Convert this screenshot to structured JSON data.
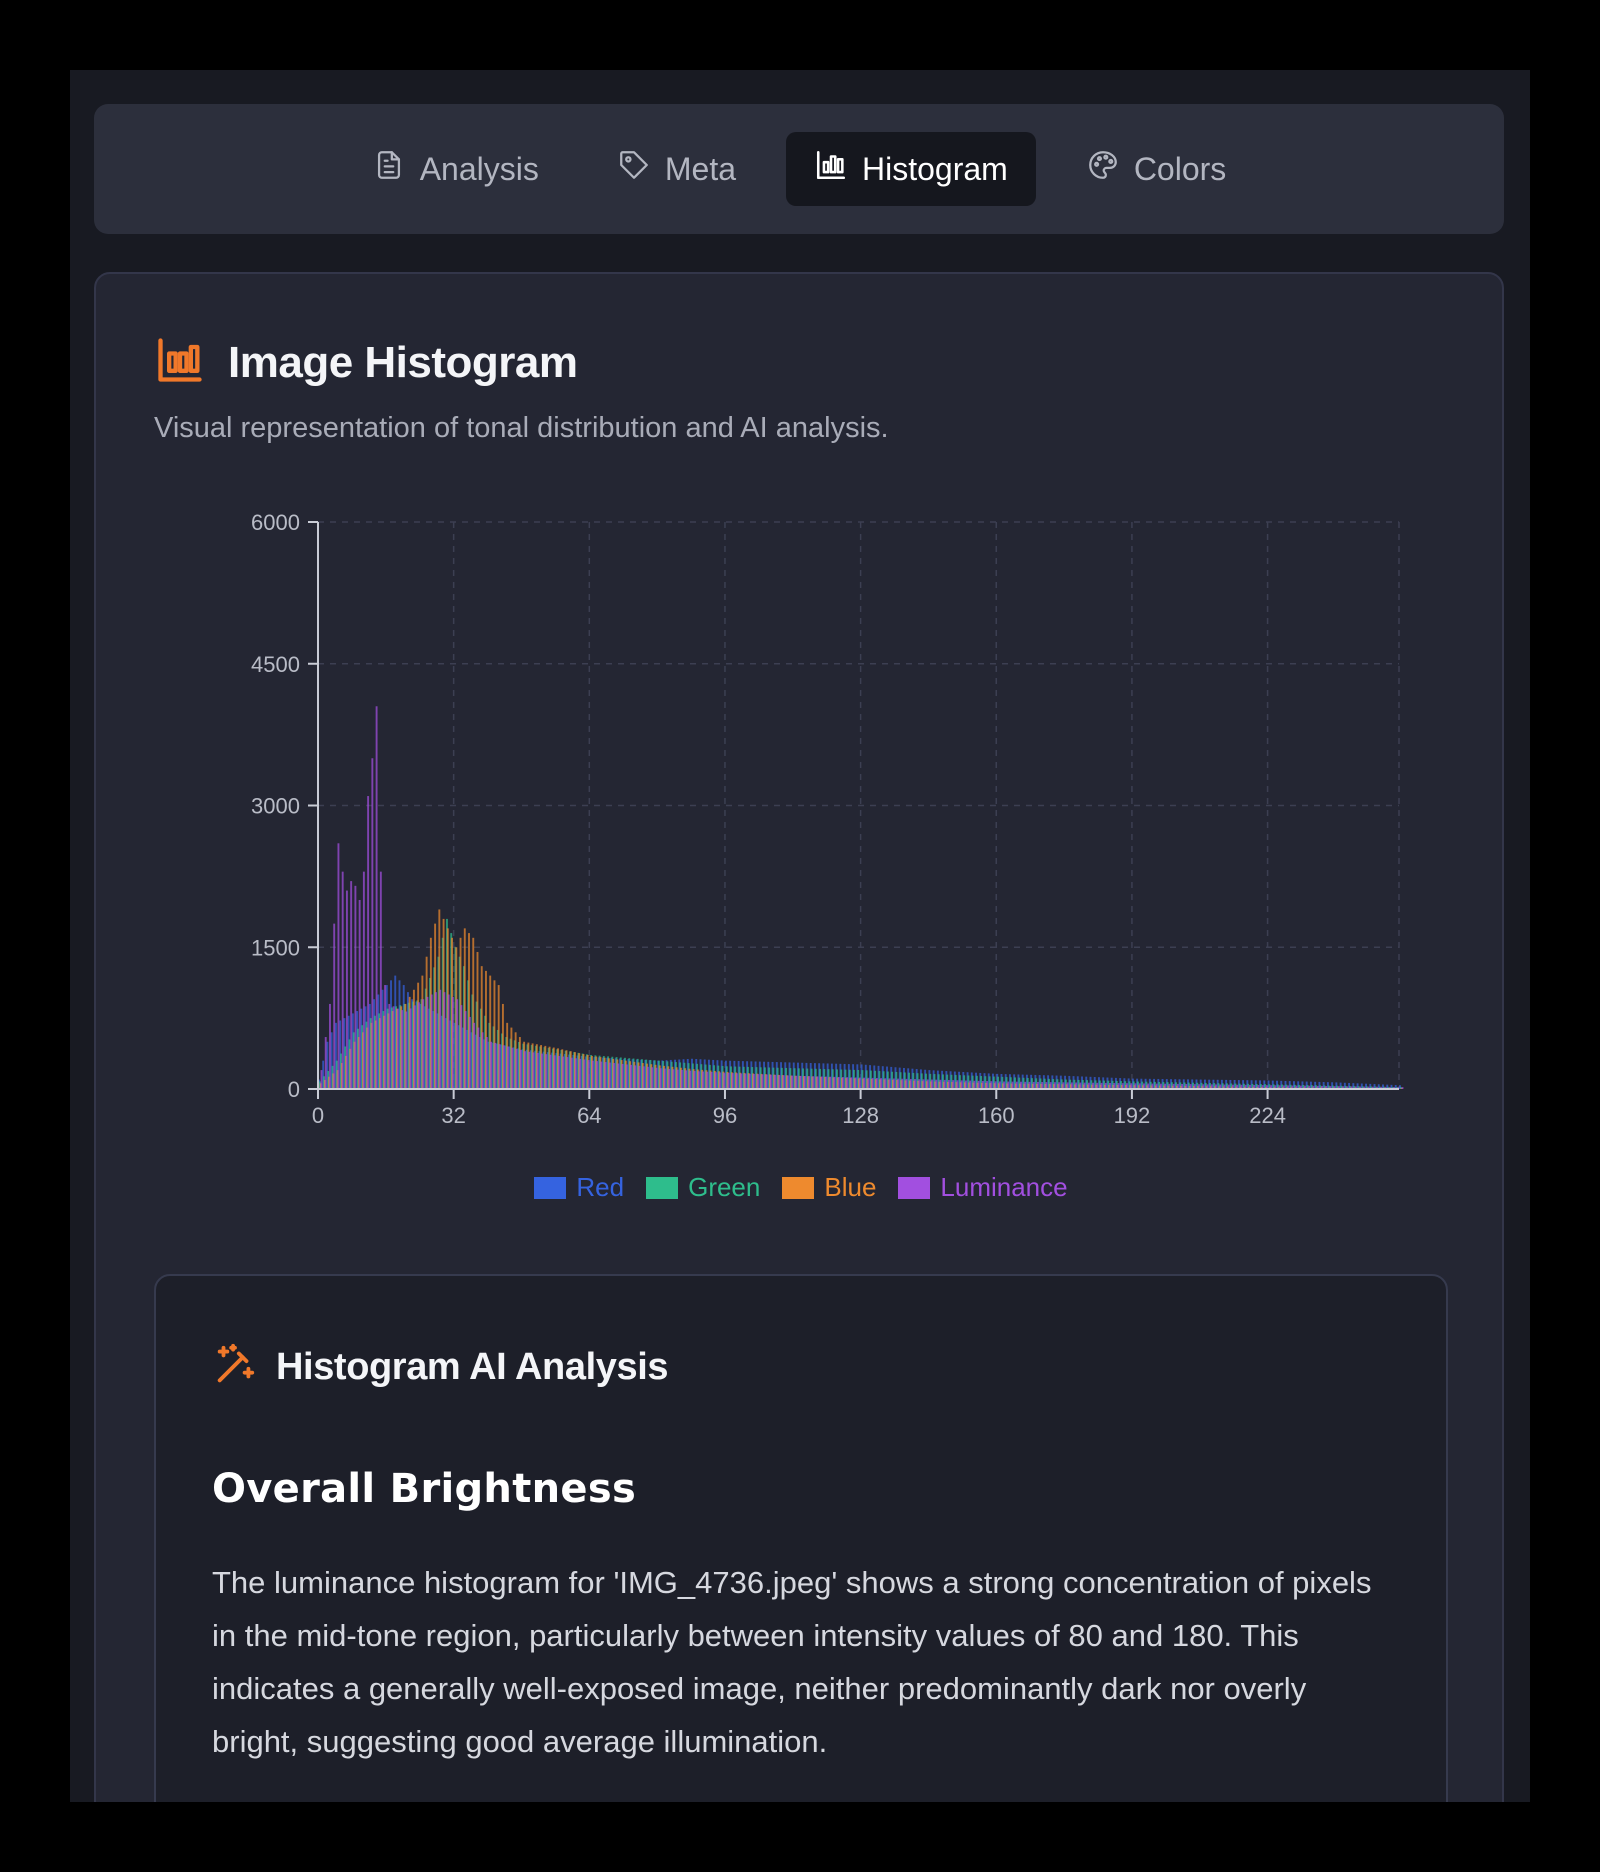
{
  "tabs": [
    {
      "label": "Analysis",
      "icon": "document-icon",
      "active": false
    },
    {
      "label": "Meta",
      "icon": "tag-icon",
      "active": false
    },
    {
      "label": "Histogram",
      "icon": "bar-chart-icon",
      "active": true
    },
    {
      "label": "Colors",
      "icon": "palette-icon",
      "active": false
    }
  ],
  "card": {
    "title": "Image Histogram",
    "subtitle": "Visual representation of tonal distribution and AI analysis."
  },
  "colors": {
    "accent": "#f0782a",
    "red": "#3563e0",
    "green": "#2ebd8c",
    "blue": "#ee8a2e",
    "luminance": "#a24fe0"
  },
  "chart_data": {
    "type": "bar",
    "x_range": [
      0,
      255
    ],
    "xticks": [
      0,
      32,
      64,
      96,
      128,
      160,
      192,
      224
    ],
    "yticks": [
      0,
      1500,
      3000,
      4500,
      6000
    ],
    "ylim": [
      0,
      6000
    ],
    "grid": true,
    "legend_position": "bottom-center",
    "series": [
      {
        "name": "Red",
        "color": "#3563e0",
        "points": [
          [
            0,
            100
          ],
          [
            2,
            500
          ],
          [
            4,
            700
          ],
          [
            6,
            750
          ],
          [
            8,
            800
          ],
          [
            10,
            850
          ],
          [
            12,
            900
          ],
          [
            14,
            1000
          ],
          [
            16,
            1100
          ],
          [
            18,
            1200
          ],
          [
            20,
            1100
          ],
          [
            22,
            950
          ],
          [
            24,
            900
          ],
          [
            26,
            850
          ],
          [
            28,
            800
          ],
          [
            30,
            750
          ],
          [
            32,
            700
          ],
          [
            36,
            600
          ],
          [
            40,
            500
          ],
          [
            48,
            420
          ],
          [
            56,
            380
          ],
          [
            64,
            340
          ],
          [
            72,
            320
          ],
          [
            80,
            300
          ],
          [
            88,
            320
          ],
          [
            96,
            300
          ],
          [
            104,
            290
          ],
          [
            112,
            280
          ],
          [
            120,
            270
          ],
          [
            128,
            260
          ],
          [
            136,
            230
          ],
          [
            144,
            200
          ],
          [
            152,
            180
          ],
          [
            160,
            160
          ],
          [
            176,
            140
          ],
          [
            192,
            110
          ],
          [
            208,
            100
          ],
          [
            224,
            90
          ],
          [
            240,
            70
          ],
          [
            255,
            40
          ]
        ]
      },
      {
        "name": "Green",
        "color": "#2ebd8c",
        "points": [
          [
            0,
            80
          ],
          [
            4,
            300
          ],
          [
            8,
            600
          ],
          [
            12,
            750
          ],
          [
            16,
            850
          ],
          [
            20,
            900
          ],
          [
            24,
            950
          ],
          [
            28,
            1400
          ],
          [
            30,
            1800
          ],
          [
            32,
            1500
          ],
          [
            34,
            1300
          ],
          [
            36,
            1000
          ],
          [
            40,
            700
          ],
          [
            44,
            550
          ],
          [
            48,
            480
          ],
          [
            56,
            420
          ],
          [
            64,
            360
          ],
          [
            72,
            330
          ],
          [
            80,
            300
          ],
          [
            88,
            270
          ],
          [
            96,
            240
          ],
          [
            112,
            220
          ],
          [
            128,
            200
          ],
          [
            144,
            160
          ],
          [
            160,
            130
          ],
          [
            176,
            100
          ],
          [
            192,
            80
          ],
          [
            224,
            50
          ],
          [
            255,
            20
          ]
        ]
      },
      {
        "name": "Blue",
        "color": "#ee8a2e",
        "points": [
          [
            0,
            60
          ],
          [
            4,
            200
          ],
          [
            8,
            500
          ],
          [
            12,
            700
          ],
          [
            16,
            800
          ],
          [
            20,
            900
          ],
          [
            24,
            1200
          ],
          [
            26,
            1600
          ],
          [
            28,
            1900
          ],
          [
            30,
            1700
          ],
          [
            32,
            1500
          ],
          [
            34,
            1700
          ],
          [
            36,
            1600
          ],
          [
            38,
            1300
          ],
          [
            40,
            1200
          ],
          [
            42,
            1100
          ],
          [
            44,
            700
          ],
          [
            48,
            500
          ],
          [
            56,
            430
          ],
          [
            64,
            350
          ],
          [
            72,
            300
          ],
          [
            80,
            250
          ],
          [
            88,
            210
          ],
          [
            96,
            180
          ],
          [
            112,
            140
          ],
          [
            128,
            110
          ],
          [
            144,
            80
          ],
          [
            160,
            60
          ],
          [
            192,
            40
          ],
          [
            224,
            20
          ],
          [
            255,
            10
          ]
        ]
      },
      {
        "name": "Luminance",
        "color": "#a24fe0",
        "points": [
          [
            0,
            200
          ],
          [
            2,
            900
          ],
          [
            4,
            2600
          ],
          [
            5,
            2300
          ],
          [
            6,
            2100
          ],
          [
            7,
            2200
          ],
          [
            8,
            2150
          ],
          [
            9,
            2000
          ],
          [
            10,
            2300
          ],
          [
            11,
            3100
          ],
          [
            12,
            3500
          ],
          [
            13,
            4050
          ],
          [
            14,
            2300
          ],
          [
            15,
            1100
          ],
          [
            16,
            900
          ],
          [
            18,
            850
          ],
          [
            20,
            820
          ],
          [
            24,
            950
          ],
          [
            28,
            1050
          ],
          [
            32,
            950
          ],
          [
            36,
            700
          ],
          [
            40,
            500
          ],
          [
            48,
            400
          ],
          [
            56,
            350
          ],
          [
            64,
            300
          ],
          [
            72,
            260
          ],
          [
            80,
            220
          ],
          [
            88,
            190
          ],
          [
            96,
            170
          ],
          [
            112,
            140
          ],
          [
            128,
            120
          ],
          [
            144,
            100
          ],
          [
            160,
            80
          ],
          [
            192,
            60
          ],
          [
            224,
            40
          ],
          [
            255,
            20
          ]
        ]
      }
    ]
  },
  "ai": {
    "title": "Histogram AI Analysis",
    "section_title": "Overall Brightness",
    "body": "The luminance histogram for 'IMG_4736.jpeg' shows a strong concentration of pixels in the mid-tone region, particularly between intensity values of 80 and 180. This indicates a generally well-exposed image, neither predominantly dark nor overly bright, suggesting good average illumination."
  }
}
